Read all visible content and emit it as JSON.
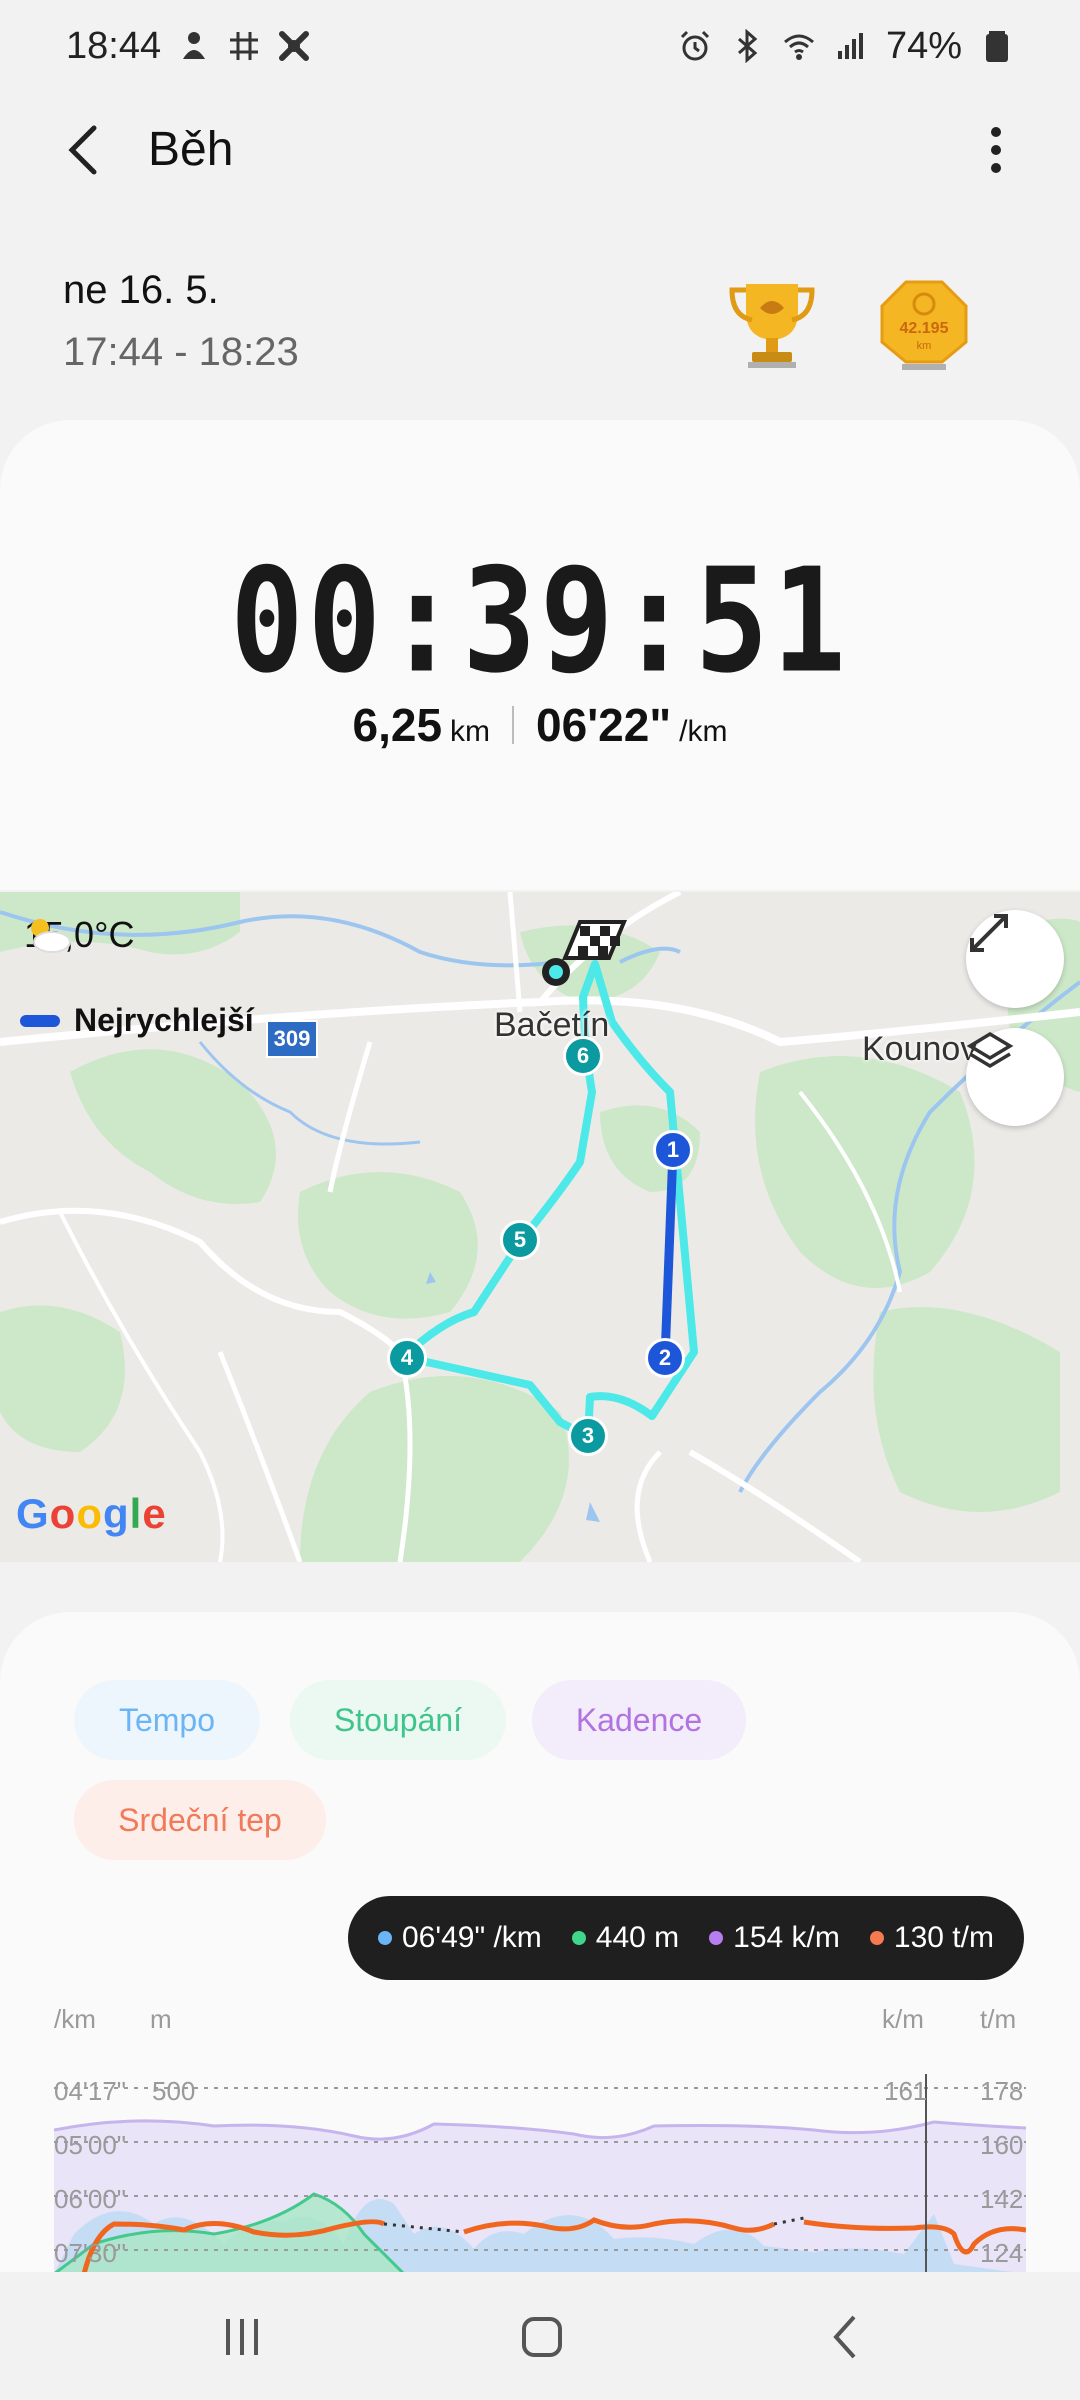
{
  "status": {
    "time": "18:44",
    "battery": "74%"
  },
  "header": {
    "title": "Běh"
  },
  "session": {
    "date": "ne 16. 5.",
    "time_range": "17:44 - 18:23"
  },
  "badges": {
    "marathon_text": "42.195",
    "marathon_unit": "km"
  },
  "summary": {
    "duration": "00:39:51",
    "distance_value": "6,25",
    "distance_unit": "km",
    "pace_value": "06'22\"",
    "pace_unit": "/km"
  },
  "map": {
    "weather": "15,0°C",
    "legend_fastest": "Nejrychlejší",
    "road_number": "309",
    "towns": [
      "Bačetín",
      "Kounov"
    ],
    "markers": [
      "1",
      "2",
      "3",
      "4",
      "5",
      "6"
    ],
    "google_logo": "Google",
    "colors": {
      "route": "#4de8e8",
      "fastest": "#1e56d9",
      "marker": "#0a9aa0"
    }
  },
  "chips": [
    {
      "label": "Tempo",
      "color": "#6bb5f5",
      "bg": "#eef6fd"
    },
    {
      "label": "Stoupání",
      "color": "#3fc58c",
      "bg": "#ecf8f2"
    },
    {
      "label": "Kadence",
      "color": "#b073e0",
      "bg": "#f3ecfa"
    },
    {
      "label": "Srdeční tep",
      "color": "#f07a5a",
      "bg": "#fdeeea"
    }
  ],
  "tooltip": {
    "pace": "06'49\" /km",
    "elevation": "440 m",
    "cadence": "154 k/m",
    "heart_rate": "130 t/m",
    "colors": {
      "pace": "#6bb5f5",
      "elevation": "#3fd68a",
      "cadence": "#b77ef0",
      "heart_rate": "#f47a52"
    }
  },
  "chart_axes": {
    "left_units": [
      "/km",
      "m"
    ],
    "right_units": [
      "k/m",
      "t/m"
    ],
    "left_ticks": [
      "04'17\"",
      "05'00\"",
      "06'00\"",
      "07'30\""
    ],
    "elevation_tick": "500",
    "cadence_tick": "161",
    "hr_ticks": [
      "178",
      "160",
      "142",
      "124"
    ]
  }
}
